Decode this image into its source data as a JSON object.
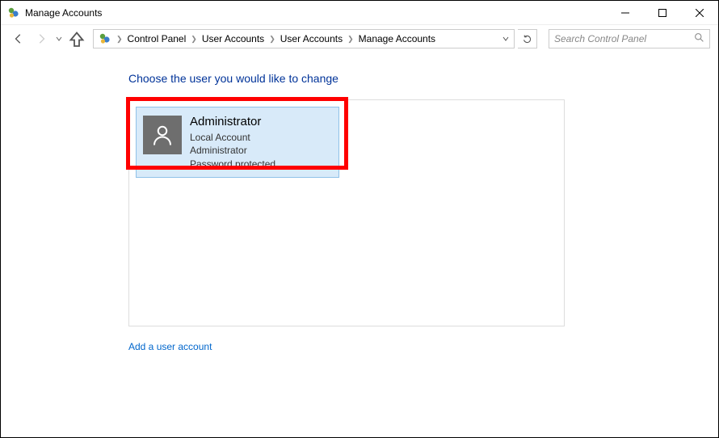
{
  "window": {
    "title": "Manage Accounts"
  },
  "breadcrumb": {
    "items": [
      {
        "label": "Control Panel"
      },
      {
        "label": "User Accounts"
      },
      {
        "label": "User Accounts"
      },
      {
        "label": "Manage Accounts"
      }
    ]
  },
  "search": {
    "placeholder": "Search Control Panel"
  },
  "main": {
    "heading": "Choose the user you would like to change",
    "account": {
      "name": "Administrator",
      "type": "Local Account",
      "role": "Administrator",
      "protection": "Password protected"
    },
    "add_link": "Add a user account"
  }
}
